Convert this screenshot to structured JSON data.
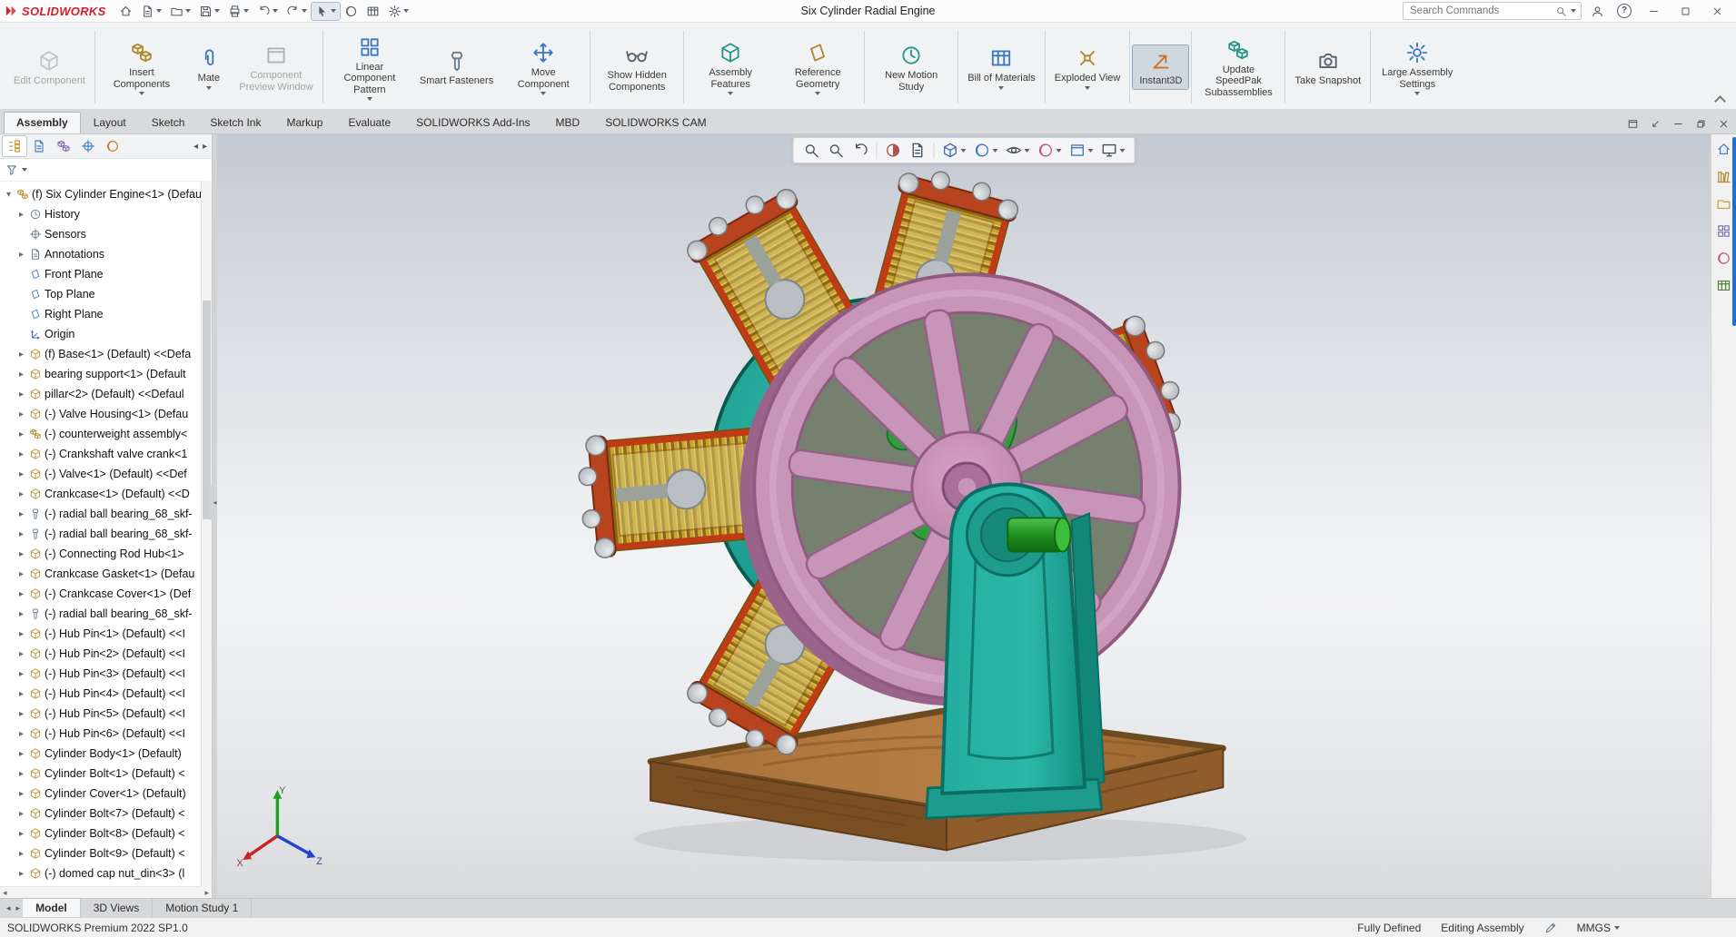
{
  "titlebar": {
    "logo_text": "SOLIDWORKS",
    "title": "Six Cylinder Radial Engine",
    "search": {
      "placeholder": "Search Commands"
    },
    "quick_icons": [
      {
        "icon": "home"
      },
      {
        "icon": "new-document",
        "caret": true
      },
      {
        "icon": "open-document",
        "caret": true
      },
      {
        "icon": "save",
        "caret": true
      },
      {
        "icon": "print",
        "caret": true
      },
      {
        "icon": "undo",
        "caret": true
      },
      {
        "icon": "redo",
        "caret": true
      },
      {
        "icon": "select-tool",
        "caret": true,
        "state": "active"
      },
      {
        "icon": "3dexperience"
      },
      {
        "icon": "file-properties"
      },
      {
        "icon": "options-gear",
        "caret": true
      }
    ]
  },
  "ribbon": {
    "buttons": [
      {
        "label": "Edit Component",
        "icon": "edit-component",
        "state": "disabled",
        "sep": true
      },
      {
        "label": "Insert Components",
        "icon": "insert-components",
        "caret": true
      },
      {
        "label": "Mate",
        "icon": "mate",
        "caret": true
      },
      {
        "label": "Component Preview Window",
        "icon": "preview-window",
        "state": "disabled",
        "sep": true
      },
      {
        "label": "Linear Component Pattern",
        "icon": "linear-pattern",
        "caret": true
      },
      {
        "label": "Smart Fasteners",
        "icon": "smart-fasteners"
      },
      {
        "label": "Move Component",
        "icon": "move-component",
        "caret": true,
        "sep": true
      },
      {
        "label": "Show Hidden Components",
        "icon": "show-hidden",
        "sep": true
      },
      {
        "label": "Assembly Features",
        "icon": "assembly-features",
        "caret": true
      },
      {
        "label": "Reference Geometry",
        "icon": "reference-geometry",
        "caret": true,
        "sep": true
      },
      {
        "label": "New Motion Study",
        "icon": "motion-study",
        "sep": true
      },
      {
        "label": "Bill of Materials",
        "icon": "bom",
        "caret": true,
        "sep": true
      },
      {
        "label": "Exploded View",
        "icon": "exploded-view",
        "caret": true,
        "sep": true
      },
      {
        "label": "Instant3D",
        "icon": "instant3d",
        "state": "active",
        "sep": true
      },
      {
        "label": "Update SpeedPak Subassemblies",
        "icon": "speedpak",
        "sep": true
      },
      {
        "label": "Take Snapshot",
        "icon": "snapshot",
        "sep": true
      },
      {
        "label": "Large Assembly Settings",
        "icon": "large-assembly",
        "caret": true
      }
    ]
  },
  "command_tabs": {
    "items": [
      {
        "label": "Assembly",
        "state": "active"
      },
      {
        "label": "Layout"
      },
      {
        "label": "Sketch"
      },
      {
        "label": "Sketch Ink"
      },
      {
        "label": "Markup"
      },
      {
        "label": "Evaluate"
      },
      {
        "label": "SOLIDWORKS Add-Ins"
      },
      {
        "label": "MBD"
      },
      {
        "label": "SOLIDWORKS CAM"
      }
    ]
  },
  "doc_controls": [
    {
      "icon": "cascade-windows"
    },
    {
      "icon": "dock-panel"
    },
    {
      "icon": "minimize-document"
    },
    {
      "icon": "restore-document"
    },
    {
      "icon": "close-document"
    }
  ],
  "feature_panel": {
    "manager_tabs": [
      {
        "icon": "featuremanager-tree",
        "state": "active"
      },
      {
        "icon": "propertymanager"
      },
      {
        "icon": "configurationmanager"
      },
      {
        "icon": "dimxpertmanager"
      },
      {
        "icon": "displaymanager"
      }
    ],
    "tree": [
      {
        "cls": "root",
        "arrow": "exp",
        "icon": "assembly",
        "label": "(f) Six Cylinder Engine<1> (Defau"
      },
      {
        "arrow": "col",
        "icon": "history",
        "label": "History"
      },
      {
        "arrow": "none",
        "icon": "sensors",
        "label": "Sensors"
      },
      {
        "arrow": "col",
        "icon": "annotations",
        "label": "Annotations"
      },
      {
        "arrow": "none",
        "icon": "plane",
        "label": "Front Plane"
      },
      {
        "arrow": "none",
        "icon": "plane",
        "label": "Top Plane"
      },
      {
        "arrow": "none",
        "icon": "plane",
        "label": "Right Plane"
      },
      {
        "arrow": "none",
        "icon": "origin",
        "label": "Origin"
      },
      {
        "arrow": "col",
        "icon": "part",
        "label": "(f) Base<1> (Default) <<Defa"
      },
      {
        "arrow": "col",
        "icon": "part",
        "label": "bearing support<1> (Default"
      },
      {
        "arrow": "col",
        "icon": "part",
        "label": "pillar<2> (Default) <<Defaul"
      },
      {
        "arrow": "col",
        "icon": "part",
        "label": "(-) Valve Housing<1> (Defau"
      },
      {
        "arrow": "col",
        "icon": "subassembly",
        "label": "(-) counterweight assembly<"
      },
      {
        "arrow": "col",
        "icon": "part",
        "label": "(-) Crankshaft valve crank<1"
      },
      {
        "arrow": "col",
        "icon": "part",
        "label": "(-) Valve<1> (Default) <<Def"
      },
      {
        "arrow": "col",
        "icon": "part",
        "label": "Crankcase<1> (Default) <<D"
      },
      {
        "arrow": "col",
        "icon": "bearing",
        "label": "(-) radial ball bearing_68_skf-"
      },
      {
        "arrow": "col",
        "icon": "bearing",
        "label": "(-) radial ball bearing_68_skf-"
      },
      {
        "arrow": "col",
        "icon": "part",
        "label": "(-) Connecting Rod Hub<1>"
      },
      {
        "arrow": "col",
        "icon": "part",
        "label": "Crankcase Gasket<1> (Defau"
      },
      {
        "arrow": "col",
        "icon": "part",
        "label": "(-) Crankcase Cover<1> (Def"
      },
      {
        "arrow": "col",
        "icon": "bearing",
        "label": "(-) radial ball bearing_68_skf-"
      },
      {
        "arrow": "col",
        "icon": "part",
        "label": "(-) Hub Pin<1> (Default) <<I"
      },
      {
        "arrow": "col",
        "icon": "part",
        "label": "(-) Hub Pin<2> (Default) <<I"
      },
      {
        "arrow": "col",
        "icon": "part",
        "label": "(-) Hub Pin<3> (Default) <<I"
      },
      {
        "arrow": "col",
        "icon": "part",
        "label": "(-) Hub Pin<4> (Default) <<I"
      },
      {
        "arrow": "col",
        "icon": "part",
        "label": "(-) Hub Pin<5> (Default) <<I"
      },
      {
        "arrow": "col",
        "icon": "part",
        "label": "(-) Hub Pin<6> (Default) <<I"
      },
      {
        "arrow": "col",
        "icon": "part",
        "label": "Cylinder Body<1> (Default)"
      },
      {
        "arrow": "col",
        "icon": "part",
        "label": "Cylinder Bolt<1> (Default) <"
      },
      {
        "arrow": "col",
        "icon": "part",
        "label": "Cylinder Cover<1> (Default)"
      },
      {
        "arrow": "col",
        "icon": "part",
        "label": "Cylinder Bolt<7> (Default) <"
      },
      {
        "arrow": "col",
        "icon": "part",
        "label": "Cylinder Bolt<8> (Default) <"
      },
      {
        "arrow": "col",
        "icon": "part",
        "label": "Cylinder Bolt<9> (Default) <"
      },
      {
        "arrow": "col",
        "icon": "part",
        "label": "(-) domed cap nut_din<3> (l"
      }
    ]
  },
  "viewport": {
    "headsup": [
      {
        "icon": "zoom-to-fit"
      },
      {
        "icon": "zoom-to-area"
      },
      {
        "icon": "previous-view",
        "sep": true
      },
      {
        "icon": "section-view"
      },
      {
        "icon": "dynamic-annotation-views",
        "sep": true
      },
      {
        "icon": "view-orientation",
        "caret": true
      },
      {
        "icon": "display-style",
        "caret": true
      },
      {
        "icon": "hide-show-items",
        "caret": true
      },
      {
        "icon": "edit-appearance",
        "caret": true
      },
      {
        "icon": "apply-scene",
        "caret": true
      },
      {
        "icon": "view-settings",
        "caret": true
      }
    ],
    "triad": {
      "x": "X",
      "y": "Y",
      "z": "Z"
    }
  },
  "task_pane": [
    {
      "icon": "task-pane-home"
    },
    {
      "icon": "design-library"
    },
    {
      "icon": "file-explorer"
    },
    {
      "icon": "view-palette"
    },
    {
      "icon": "appearances-scenes"
    },
    {
      "icon": "custom-properties"
    }
  ],
  "model_tabs": {
    "items": [
      {
        "label": "Model",
        "state": "active"
      },
      {
        "label": "3D Views"
      },
      {
        "label": "Motion Study 1"
      }
    ]
  },
  "statusbar": {
    "left": "SOLIDWORKS Premium 2022 SP1.0",
    "status": "Fully Defined",
    "mode": "Editing Assembly",
    "units": "MMGS"
  },
  "colors": {
    "brand_red": "#d1202a",
    "model_teal": "#1fa193",
    "model_pink": "#c795b7",
    "model_gold": "#c9a232",
    "model_green": "#2f9e3a",
    "model_wood": "#a9713a"
  }
}
